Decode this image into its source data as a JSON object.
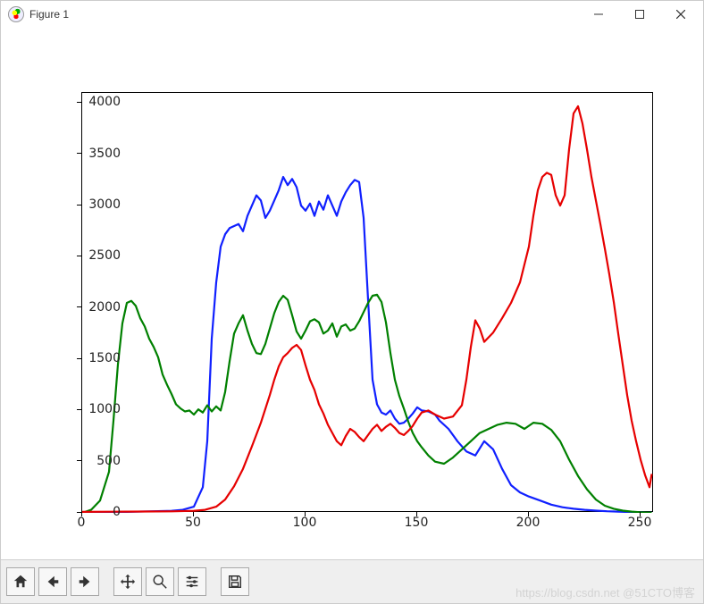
{
  "window": {
    "title": "Figure 1",
    "minimize_tip": "Minimize",
    "maximize_tip": "Maximize",
    "close_tip": "Close"
  },
  "toolbar": {
    "home": "Home",
    "back": "Back",
    "forward": "Forward",
    "pan": "Pan",
    "zoom": "Zoom",
    "config": "Configure subplots",
    "save": "Save"
  },
  "watermark": "https://blog.csdn.net @51CTO博客",
  "chart_data": {
    "type": "line",
    "title": "",
    "xlabel": "",
    "ylabel": "",
    "xlim": [
      0,
      256
    ],
    "ylim": [
      0,
      4100
    ],
    "xticks": [
      0,
      50,
      100,
      150,
      200,
      250
    ],
    "yticks": [
      0,
      500,
      1000,
      1500,
      2000,
      2500,
      3000,
      3500,
      4000
    ],
    "series": [
      {
        "name": "blue",
        "color": "#1020ff",
        "x": [
          0,
          10,
          20,
          30,
          40,
          45,
          50,
          54,
          56,
          58,
          60,
          62,
          64,
          66,
          68,
          70,
          72,
          74,
          76,
          78,
          80,
          82,
          84,
          86,
          88,
          90,
          92,
          94,
          96,
          98,
          100,
          102,
          104,
          106,
          108,
          110,
          112,
          114,
          116,
          118,
          120,
          122,
          124,
          126,
          128,
          130,
          132,
          134,
          136,
          138,
          140,
          142,
          144,
          146,
          148,
          150,
          152,
          155,
          158,
          160,
          164,
          168,
          172,
          176,
          180,
          184,
          188,
          192,
          196,
          200,
          205,
          210,
          215,
          220,
          225,
          230,
          235,
          240,
          245,
          250,
          255
        ],
        "values": [
          0,
          5,
          10,
          15,
          20,
          30,
          60,
          250,
          700,
          1700,
          2250,
          2600,
          2720,
          2780,
          2800,
          2820,
          2750,
          2900,
          3000,
          3100,
          3050,
          2880,
          2950,
          3050,
          3150,
          3280,
          3200,
          3260,
          3180,
          3000,
          2950,
          3020,
          2900,
          3040,
          2960,
          3100,
          3000,
          2900,
          3040,
          3130,
          3200,
          3250,
          3230,
          2880,
          2080,
          1300,
          1060,
          980,
          960,
          1000,
          920,
          870,
          880,
          920,
          970,
          1030,
          1000,
          990,
          960,
          900,
          820,
          700,
          600,
          560,
          700,
          620,
          430,
          270,
          200,
          160,
          120,
          80,
          55,
          40,
          30,
          22,
          16,
          12,
          8,
          5,
          3
        ]
      },
      {
        "name": "green",
        "color": "#008000",
        "x": [
          0,
          4,
          8,
          12,
          14,
          16,
          18,
          20,
          22,
          24,
          26,
          28,
          30,
          32,
          34,
          36,
          38,
          40,
          42,
          44,
          46,
          48,
          50,
          52,
          54,
          56,
          58,
          60,
          62,
          64,
          66,
          68,
          70,
          72,
          74,
          76,
          78,
          80,
          82,
          84,
          86,
          88,
          90,
          92,
          94,
          96,
          98,
          100,
          102,
          104,
          106,
          108,
          110,
          112,
          114,
          116,
          118,
          120,
          122,
          124,
          126,
          128,
          130,
          132,
          134,
          136,
          138,
          140,
          142,
          144,
          146,
          148,
          150,
          152,
          155,
          158,
          162,
          166,
          170,
          174,
          178,
          182,
          186,
          190,
          194,
          198,
          202,
          206,
          210,
          214,
          218,
          222,
          226,
          230,
          234,
          238,
          242,
          246,
          250,
          255
        ],
        "values": [
          0,
          30,
          120,
          400,
          900,
          1450,
          1850,
          2050,
          2070,
          2020,
          1900,
          1820,
          1700,
          1620,
          1520,
          1350,
          1250,
          1160,
          1060,
          1020,
          990,
          1000,
          960,
          1010,
          980,
          1050,
          990,
          1040,
          1000,
          1180,
          1480,
          1750,
          1850,
          1930,
          1780,
          1650,
          1560,
          1550,
          1650,
          1800,
          1950,
          2060,
          2120,
          2080,
          1930,
          1770,
          1700,
          1780,
          1870,
          1890,
          1860,
          1750,
          1780,
          1850,
          1720,
          1820,
          1840,
          1780,
          1800,
          1870,
          1960,
          2050,
          2120,
          2130,
          2060,
          1860,
          1560,
          1300,
          1140,
          1020,
          890,
          780,
          700,
          640,
          560,
          500,
          480,
          540,
          620,
          700,
          780,
          820,
          860,
          880,
          870,
          820,
          880,
          870,
          810,
          700,
          520,
          360,
          230,
          130,
          70,
          40,
          22,
          12,
          6,
          2
        ]
      },
      {
        "name": "red",
        "color": "#e60000",
        "x": [
          0,
          20,
          40,
          50,
          55,
          60,
          64,
          68,
          72,
          76,
          80,
          84,
          86,
          88,
          90,
          92,
          94,
          96,
          98,
          100,
          102,
          104,
          106,
          108,
          110,
          112,
          114,
          116,
          118,
          120,
          122,
          124,
          126,
          128,
          130,
          132,
          134,
          136,
          138,
          140,
          142,
          144,
          146,
          148,
          150,
          152,
          155,
          158,
          162,
          166,
          170,
          172,
          174,
          176,
          178,
          180,
          184,
          188,
          192,
          196,
          200,
          202,
          204,
          206,
          208,
          210,
          212,
          214,
          216,
          218,
          220,
          222,
          224,
          226,
          228,
          230,
          232,
          234,
          236,
          238,
          240,
          242,
          244,
          246,
          248,
          250,
          252,
          254,
          255
        ],
        "values": [
          10,
          12,
          15,
          20,
          30,
          60,
          130,
          260,
          430,
          650,
          880,
          1150,
          1300,
          1430,
          1520,
          1560,
          1610,
          1640,
          1590,
          1440,
          1300,
          1200,
          1060,
          970,
          860,
          780,
          700,
          660,
          750,
          820,
          790,
          740,
          700,
          760,
          820,
          860,
          800,
          840,
          870,
          830,
          780,
          760,
          800,
          850,
          920,
          980,
          1000,
          960,
          920,
          940,
          1050,
          1300,
          1620,
          1880,
          1800,
          1670,
          1760,
          1900,
          2050,
          2250,
          2600,
          2900,
          3150,
          3280,
          3320,
          3300,
          3100,
          3000,
          3100,
          3550,
          3900,
          3970,
          3800,
          3550,
          3280,
          3050,
          2820,
          2580,
          2330,
          2060,
          1750,
          1450,
          1150,
          900,
          700,
          520,
          370,
          250,
          380
        ]
      }
    ]
  }
}
